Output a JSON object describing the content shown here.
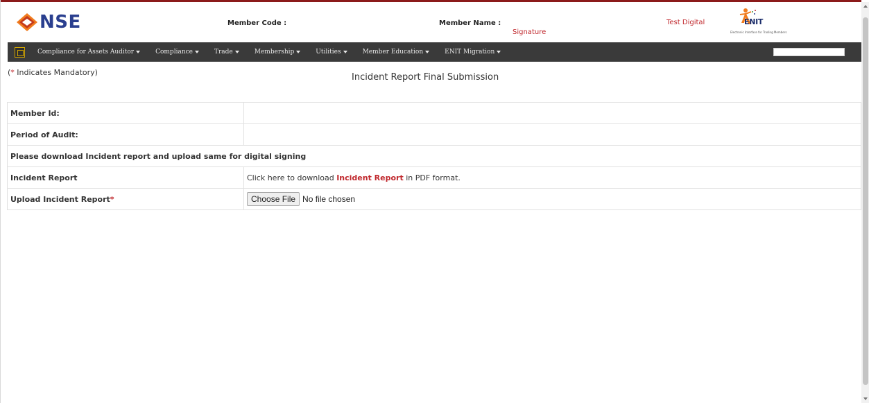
{
  "header": {
    "logo_text": "NSE",
    "member_code_label": "Member Code :",
    "member_name_label": "Member Name :",
    "signature_text": "Signature",
    "test_digital_text": "Test Digital",
    "enit_logo_text": "ENIT",
    "enit_tagline": "Electronic Interface for Trading Members",
    "accent_color": "#c0282d",
    "brand_color": "#2a3f8f"
  },
  "nav": {
    "items": [
      "Compliance for Assets Auditor",
      "Compliance",
      "Trade",
      "Membership",
      "Utilities",
      "Member Education",
      "ENIT Migration"
    ],
    "background_color": "#3a3a3a"
  },
  "page": {
    "mandatory_star": "*",
    "mandatory_text": " Indicates Mandatory)",
    "mandatory_open": "(",
    "title": "Incident Report Final Submission"
  },
  "form": {
    "member_id_label": "Member Id:",
    "member_id_value": "",
    "period_label": "Period of Audit:",
    "period_value": "",
    "instruction": "Please download Incident report and upload same for digital signing",
    "incident_report_label": "Incident Report",
    "download_prefix": "Click here to download ",
    "download_link": "Incident Report",
    "download_suffix": " in PDF format.",
    "upload_label": "Upload Incident Report",
    "upload_required": "*",
    "file_button_label": "Choose File",
    "file_status": "No file chosen"
  }
}
